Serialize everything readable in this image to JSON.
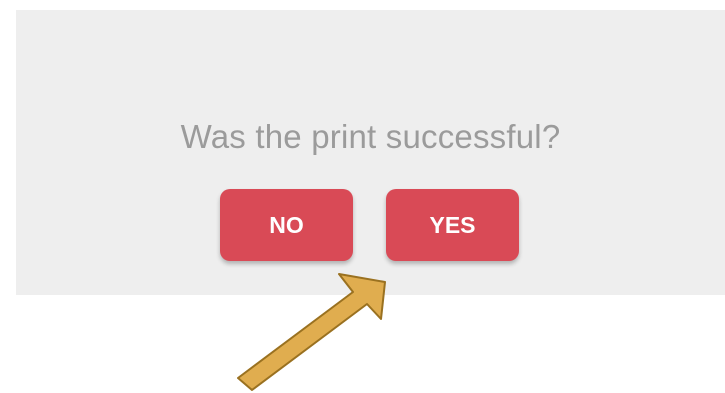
{
  "dialog": {
    "question": "Was the print successful?",
    "no_label": "NO",
    "yes_label": "YES"
  },
  "annotation": {
    "icon": "pointer-arrow-icon",
    "color": "#e0ad4f"
  },
  "colors": {
    "dialog_background": "#eeeeee",
    "button": "#d94a56",
    "button_text": "#ffffff",
    "question_text": "#9b9b9b"
  }
}
